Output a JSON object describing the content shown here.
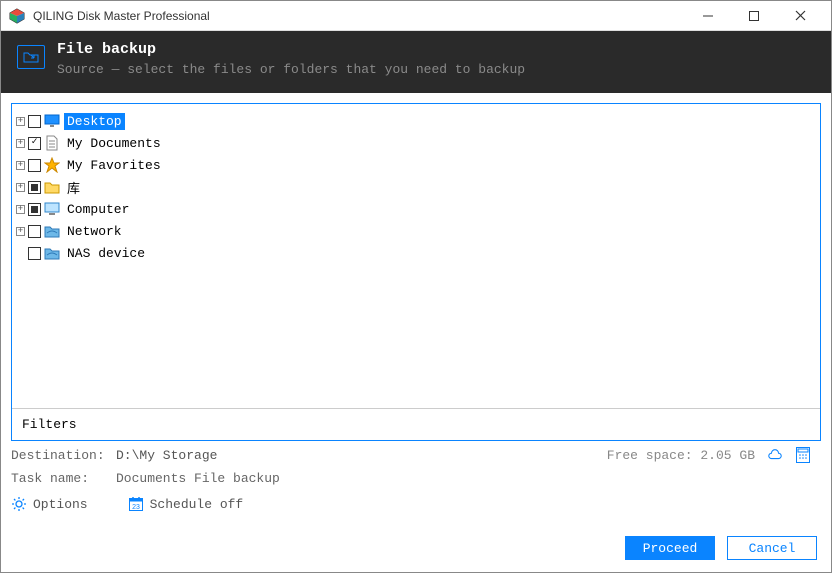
{
  "window": {
    "title": "QILING Disk Master Professional"
  },
  "header": {
    "title": "File backup",
    "subtitle": "Source — select the files or folders that you need to backup"
  },
  "tree": {
    "items": [
      {
        "label": "Desktop",
        "expandable": true,
        "check": "unchecked",
        "icon": "desktop",
        "selected": true
      },
      {
        "label": "My Documents",
        "expandable": true,
        "check": "checked",
        "icon": "doc",
        "selected": false
      },
      {
        "label": "My Favorites",
        "expandable": true,
        "check": "unchecked",
        "icon": "star",
        "selected": false
      },
      {
        "label": "库",
        "expandable": true,
        "check": "partial",
        "icon": "folder",
        "selected": false
      },
      {
        "label": "Computer",
        "expandable": true,
        "check": "partial",
        "icon": "computer",
        "selected": false
      },
      {
        "label": "Network",
        "expandable": true,
        "check": "unchecked",
        "icon": "net",
        "selected": false
      },
      {
        "label": "NAS device",
        "expandable": false,
        "check": "unchecked",
        "icon": "net",
        "selected": false
      }
    ]
  },
  "filters_label": "Filters",
  "destination": {
    "label": "Destination:",
    "value": "D:\\My Storage",
    "free_space": "Free space: 2.05 GB"
  },
  "task": {
    "label": "Task name:",
    "value": "Documents File backup"
  },
  "options": {
    "options_label": "Options",
    "schedule_label": "Schedule off"
  },
  "buttons": {
    "proceed": "Proceed",
    "cancel": "Cancel"
  }
}
